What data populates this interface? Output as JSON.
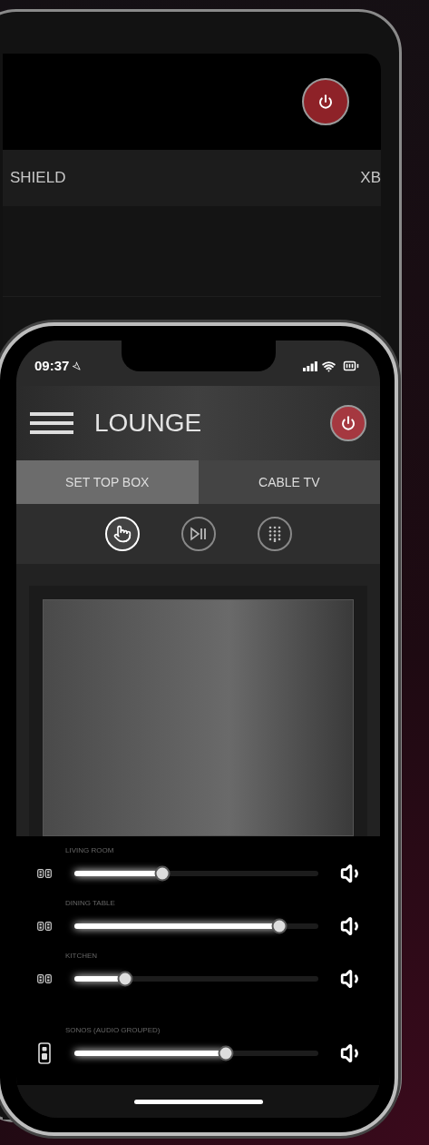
{
  "tablet": {
    "tabs": [
      {
        "label": "SHIELD",
        "selected": false
      },
      {
        "label": "XB",
        "selected": false
      }
    ]
  },
  "phone": {
    "status_bar": {
      "time": "09:37"
    },
    "header": {
      "title": "LOUNGE"
    },
    "tabs": [
      {
        "label": "SET TOP BOX",
        "selected": true
      },
      {
        "label": "CABLE TV",
        "selected": false
      }
    ],
    "modes": [
      {
        "kind": "touch",
        "selected": true
      },
      {
        "kind": "play_pause",
        "selected": false
      },
      {
        "kind": "keypad",
        "selected": false
      }
    ],
    "zones": [
      {
        "name": "LIVING ROOM",
        "kind": "pair",
        "level": 0.36
      },
      {
        "name": "DINING TABLE",
        "kind": "pair",
        "level": 0.84
      },
      {
        "name": "KITCHEN",
        "kind": "pair",
        "level": 0.21
      },
      {
        "name": "SONOS (AUDIO GROUPED)",
        "kind": "single",
        "level": 0.62
      }
    ]
  }
}
